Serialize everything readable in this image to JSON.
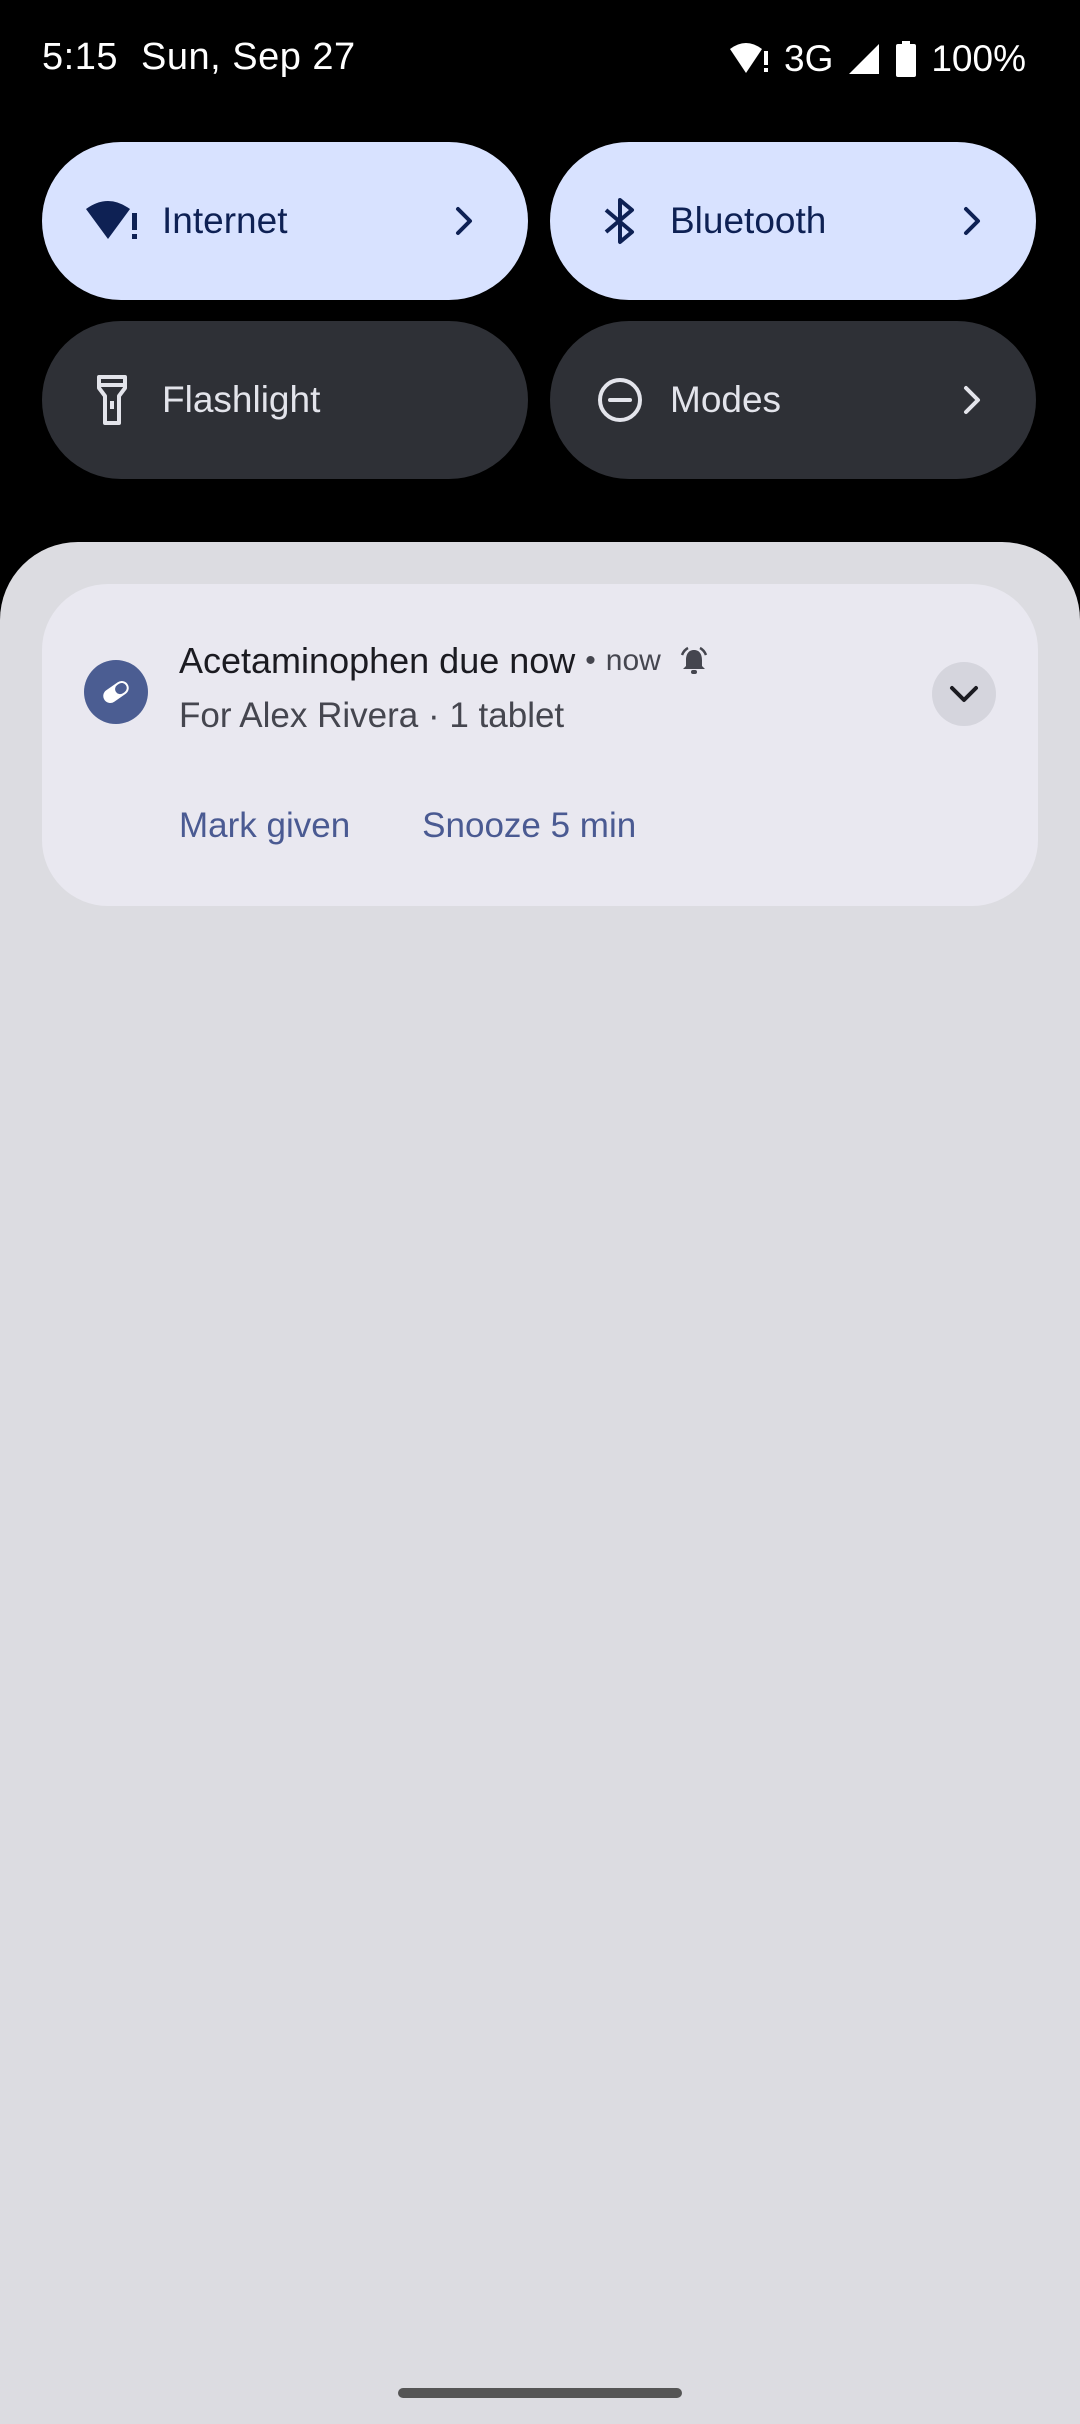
{
  "status_bar": {
    "time": "5:15",
    "date": "Sun, Sep 27",
    "network": "3G",
    "battery": "100%"
  },
  "quick_settings": {
    "tiles": [
      {
        "label": "Internet",
        "icon": "wifi-alert-icon",
        "active": true
      },
      {
        "label": "Bluetooth",
        "icon": "bluetooth-icon",
        "active": true
      },
      {
        "label": "Flashlight",
        "icon": "flashlight-icon",
        "active": false
      },
      {
        "label": "Modes",
        "icon": "do-not-disturb-icon",
        "active": false
      }
    ]
  },
  "notification": {
    "app_icon": "pill-icon",
    "title": "Acetaminophen due now",
    "separator": "•",
    "time": "now",
    "text": "For Alex Rivera · 1 tablet",
    "actions": [
      "Mark given",
      "Snooze 5 min"
    ]
  },
  "colors": {
    "tile_active": "#d8e2ff",
    "tile_inactive": "#2e3036",
    "shade_bg": "#dcdce1",
    "card_bg": "#e9e8f0",
    "accent": "#4a5a92"
  }
}
